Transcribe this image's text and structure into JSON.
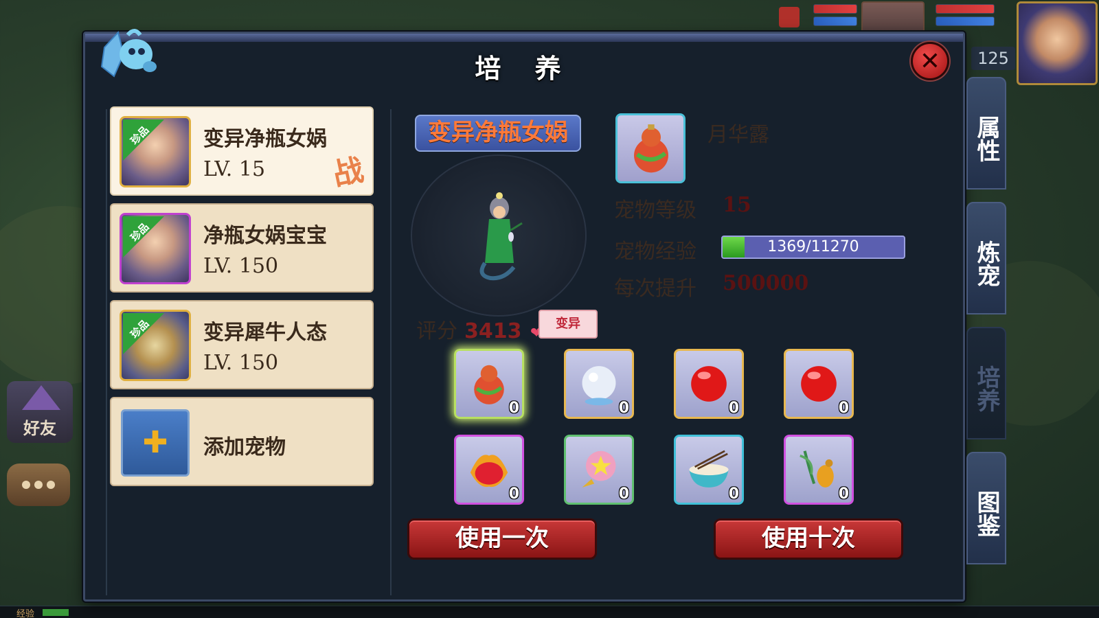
{
  "hud": {
    "hero_level": "125"
  },
  "side_buttons": {
    "friends_label": "好友"
  },
  "bottom_bar": {
    "exp_label": "经验"
  },
  "dialog": {
    "title": "培 养",
    "close_label": "✕"
  },
  "pets": [
    {
      "name": "变异净瓶女娲",
      "level": "LV. 15",
      "badge": "珍品",
      "status_stamp": "战",
      "active": true
    },
    {
      "name": "净瓶女娲宝宝",
      "level": "LV. 150",
      "badge": "珍品",
      "active": false
    },
    {
      "name": "变异犀牛人态",
      "level": "LV. 150",
      "badge": "珍品",
      "active": false
    }
  ],
  "add_pet": {
    "label": "添加宠物",
    "icon": "plus-icon"
  },
  "selected_pet": {
    "name": "变异净瓶女娲",
    "score_label": "评分",
    "score": "3413",
    "mutation_tag": "变异"
  },
  "item_info": {
    "item_name": "月华露",
    "icon": "gourd-icon"
  },
  "stats": {
    "level_label": "宠物等级",
    "level_value": "15",
    "exp_label": "宠物经验",
    "exp_text": "1369/11270",
    "exp_current": 1369,
    "exp_max": 11270,
    "boost_label": "每次提升",
    "boost_value": "500000"
  },
  "items": [
    {
      "name": "gourd-icon",
      "count": "0"
    },
    {
      "name": "pearl-icon",
      "count": "0"
    },
    {
      "name": "red-orb-icon",
      "count": "0"
    },
    {
      "name": "red-orb-icon",
      "count": "0"
    },
    {
      "name": "fire-fruit-icon",
      "count": "0"
    },
    {
      "name": "star-candy-icon",
      "count": "0"
    },
    {
      "name": "noodle-bowl-icon",
      "count": "0"
    },
    {
      "name": "gourd-leaf-icon",
      "count": "0"
    }
  ],
  "buttons": {
    "use_once": "使用一次",
    "use_ten": "使用十次"
  },
  "tabs": [
    {
      "label": "属性"
    },
    {
      "label": "炼宠"
    },
    {
      "label": "培养"
    },
    {
      "label": "图鉴"
    }
  ],
  "colors": {
    "dialog_bg": "#16202c",
    "card_bg": "#efe0c4",
    "accent_orange": "#ff7a3a",
    "button_red": "#c83838"
  }
}
